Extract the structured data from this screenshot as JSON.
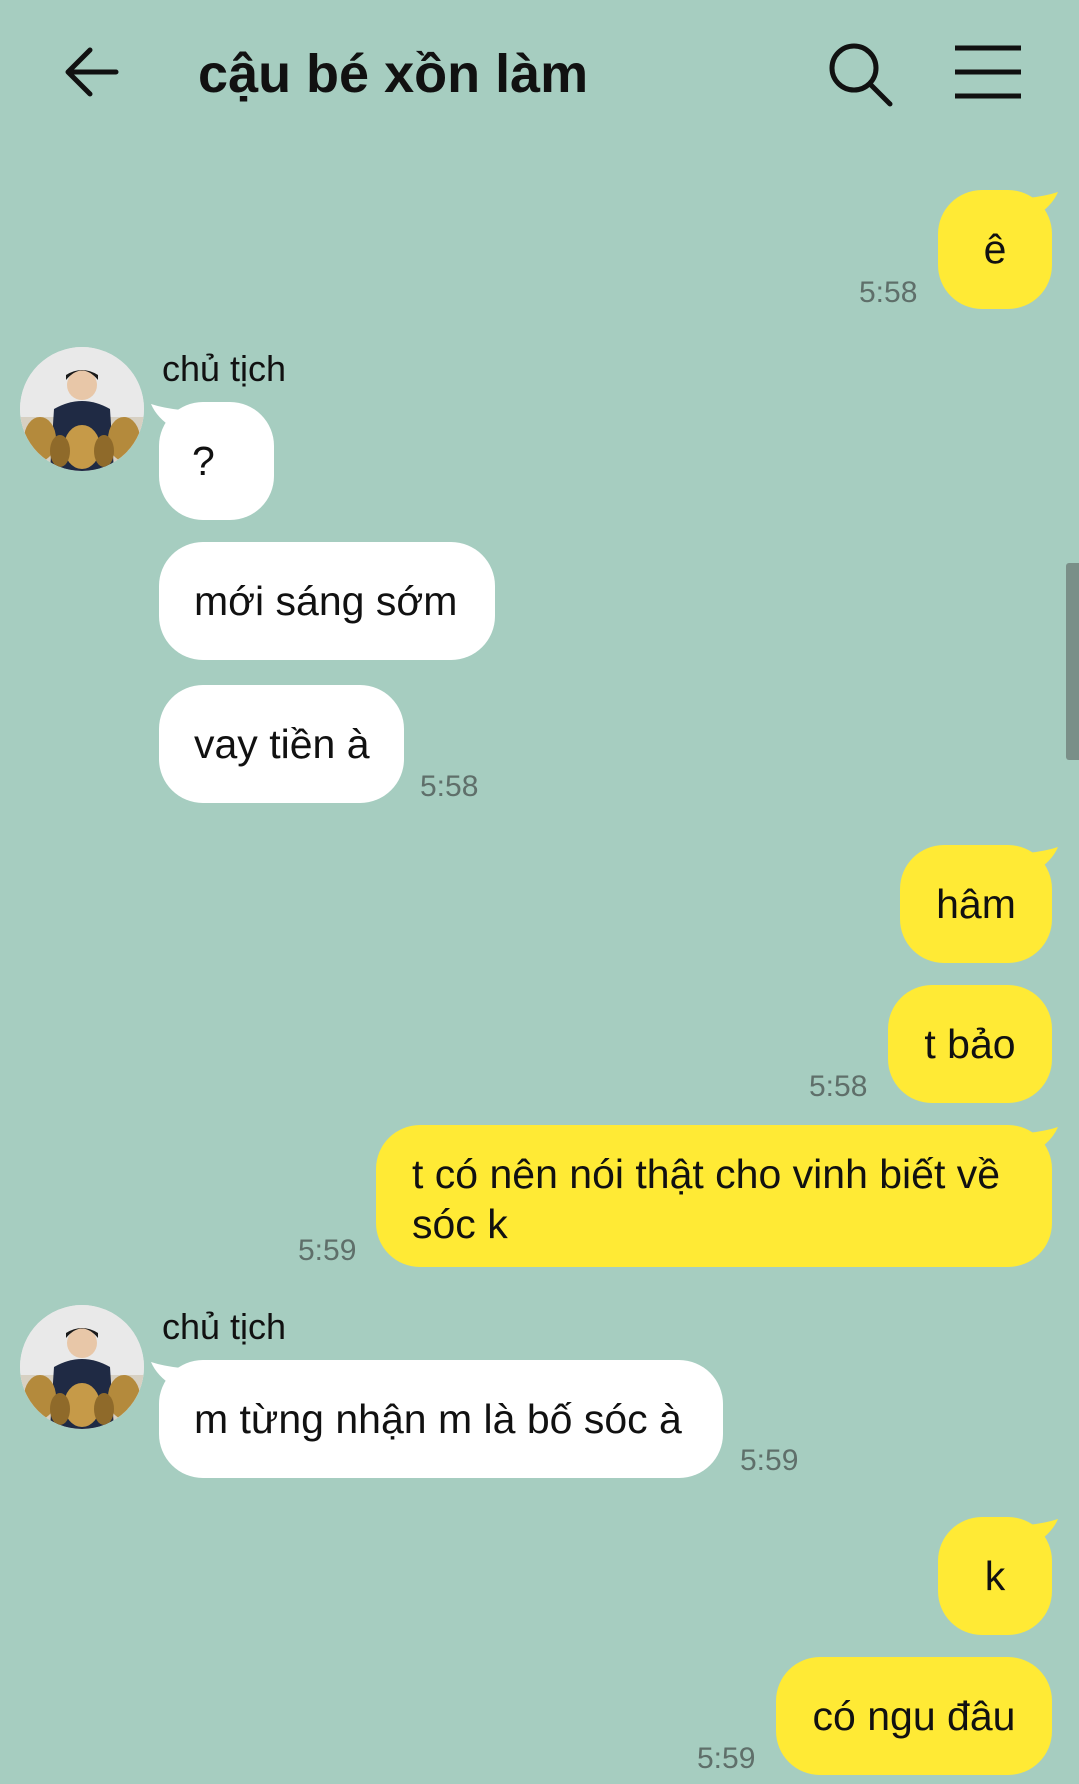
{
  "header": {
    "title": "cậu bé xồn làm"
  },
  "icons": {
    "back": "arrow-left-icon",
    "search": "search-icon",
    "menu": "hamburger-menu-icon"
  },
  "colors": {
    "background": "#a6cdc0",
    "outgoing_bubble": "#ffea35",
    "incoming_bubble": "#ffffff",
    "timestamp": "#5f6f6a"
  },
  "messages": {
    "m1": {
      "text": "ê",
      "time": "5:58"
    },
    "group1": {
      "sender": "chủ tịch",
      "texts": [
        "?",
        "mới sáng sớm",
        "vay tiền à"
      ],
      "time": "5:58"
    },
    "m2": {
      "text": "hâm"
    },
    "m3": {
      "text": "t bảo",
      "time": "5:58"
    },
    "m4": {
      "line1": "t có nên nói thật cho vinh biết về",
      "line2": "sóc k",
      "time": "5:59"
    },
    "group2": {
      "sender": "chủ tịch",
      "text": "m từng nhận m là bố sóc à",
      "time": "5:59"
    },
    "m5": {
      "text": "k"
    },
    "m6": {
      "text": "có ngu đâu",
      "time": "5:59"
    }
  }
}
